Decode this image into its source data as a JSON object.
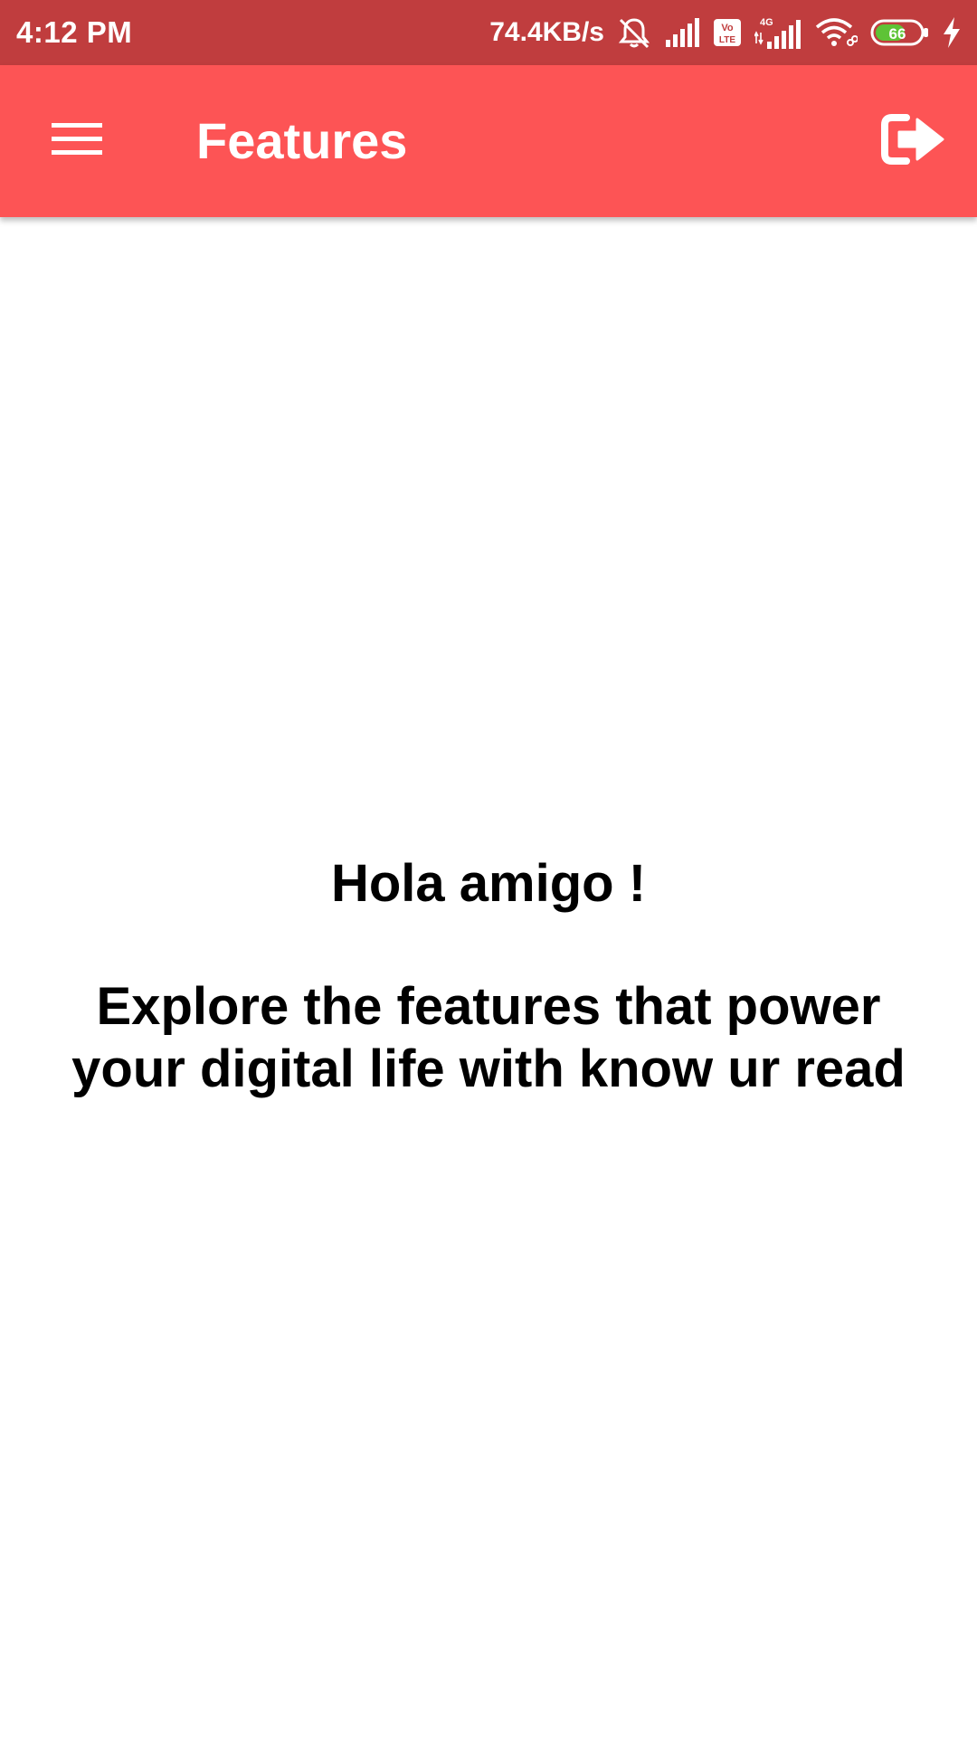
{
  "status_bar": {
    "time": "4:12 PM",
    "network_speed": "74.4KB/s",
    "volte_label": "Vo LTE",
    "network_type": "4G",
    "battery_level": "66",
    "icons": [
      "bell-off-icon",
      "signal-icon",
      "volte-icon",
      "signal-4g-icon",
      "wifi-icon",
      "battery-icon",
      "charging-icon"
    ]
  },
  "app_bar": {
    "title": "Features",
    "menu_icon": "hamburger-menu-icon",
    "action_icon": "logout-icon"
  },
  "main": {
    "greeting": "Hola amigo !",
    "subtitle": "Explore the features that power your digital life with know ur read"
  },
  "colors": {
    "status_bar": "#c03d3e",
    "app_bar": "#fd5455",
    "text": "#000000",
    "background": "#ffffff",
    "battery_fill": "#5ec336"
  }
}
